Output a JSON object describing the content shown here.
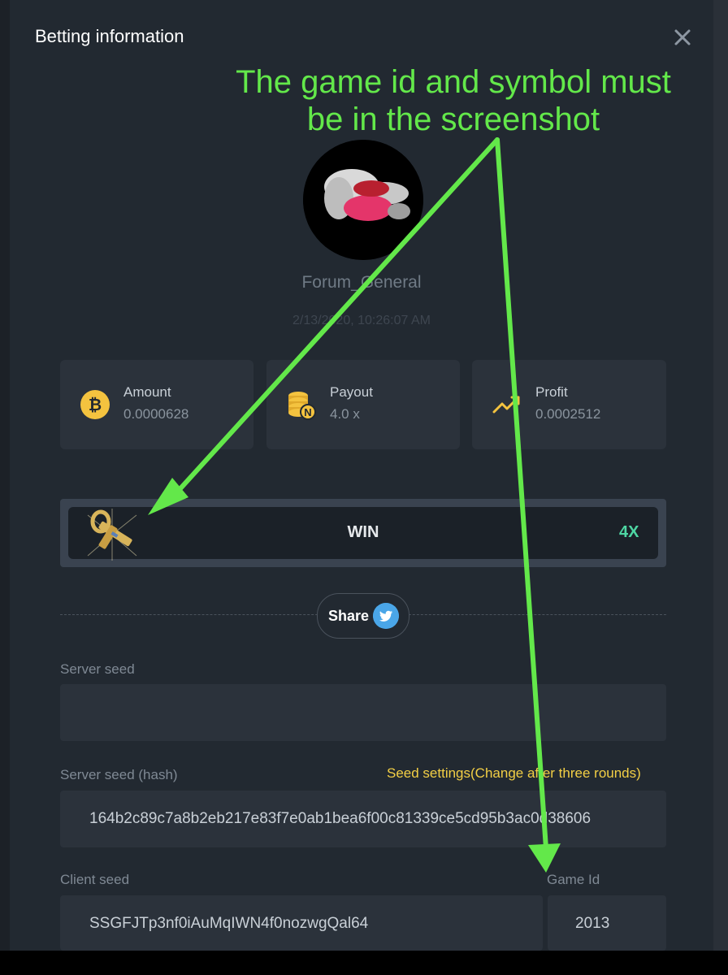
{
  "modal": {
    "title": "Betting information"
  },
  "player": {
    "username": "Forum_General",
    "datetime": "2/13/2020, 10:26:07 AM"
  },
  "stats": [
    {
      "label": "Amount",
      "value": "0.0000628",
      "icon": "bitcoin-icon"
    },
    {
      "label": "Payout",
      "value": "4.0 x",
      "icon": "coins-stack-icon"
    },
    {
      "label": "Profit",
      "value": "0.0002512",
      "icon": "trend-up-icon"
    }
  ],
  "result": {
    "label": "WIN",
    "multiplier": "4X",
    "symbol_icon": "ankh-symbol-icon"
  },
  "share": {
    "label": "Share"
  },
  "fields": {
    "server_seed_label": "Server seed",
    "server_seed_value": "",
    "server_seed_hash_label": "Server seed (hash)",
    "seed_settings_link": "Seed settings(Change after three rounds)",
    "server_seed_hash_value": "164b2c89c7a8b2eb217e83f7e0ab1bea6f00c81339ce5cd95b3ac0d38606",
    "client_seed_label": "Client seed",
    "client_seed_value": "SSGFJTp3nf0iAuMqIWN4f0nozwgQal64",
    "game_id_label": "Game Id",
    "game_id_value": "2013"
  },
  "annotation": {
    "line1": "The game id and symbol must",
    "line2": "be in the screenshot"
  },
  "colors": {
    "accent_green": "#4ed6a3",
    "link_yellow": "#f3cf45",
    "annotation_green": "#63e84a",
    "modal_bg": "#222931"
  }
}
